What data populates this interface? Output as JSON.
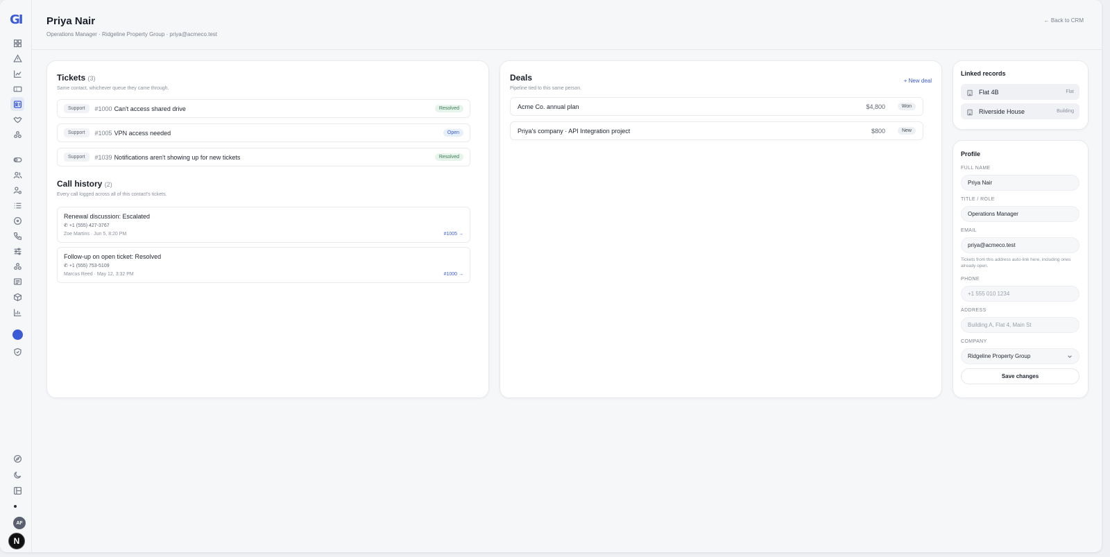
{
  "header": {
    "title": "Priya Nair",
    "subtitle": "Operations Manager · Ridgeline Property Group · priya@acmeco.test",
    "back_label": "← Back to CRM"
  },
  "sidebar": {
    "logo": "GI",
    "items": [
      "dashboard-icon",
      "alert-icon",
      "chart-icon",
      "ticket-icon",
      "contacts-icon",
      "handshake-icon",
      "integrations-icon",
      "toggle-icon",
      "users-icon",
      "user-settings-icon",
      "list-icon",
      "circle-icon",
      "phone-icon",
      "sliders-icon",
      "apps-icon",
      "message-icon",
      "box-icon",
      "bar-chart-icon",
      "shield-icon"
    ],
    "footer_items": [
      "compass-icon",
      "moon-icon",
      "layout-icon"
    ],
    "avatar_initials": "AF",
    "badge_letter": "N"
  },
  "tickets": {
    "title": "Tickets",
    "count": "(3)",
    "description": "Same contact, whichever queue they came through.",
    "items": [
      {
        "queue": "Support",
        "number": "#1000",
        "title": "Can't access shared drive",
        "status": "Resolved",
        "status_kind": "resolved"
      },
      {
        "queue": "Support",
        "number": "#1005",
        "title": "VPN access needed",
        "status": "Open",
        "status_kind": "open"
      },
      {
        "queue": "Support",
        "number": "#1039",
        "title": "Notifications aren't showing up for new tickets",
        "status": "Resolved",
        "status_kind": "resolved"
      }
    ]
  },
  "calls": {
    "title": "Call history",
    "count": "(2)",
    "description": "Every call logged across all of this contact's tickets.",
    "items": [
      {
        "title": "Renewal discussion: Escalated",
        "phone": "+1 (555) 427-3767",
        "meta": "Zoe Martins · Jun 5, 8:20 PM",
        "link": "#1005 →"
      },
      {
        "title": "Follow-up on open ticket: Resolved",
        "phone": "+1 (555) 753-5109",
        "meta": "Marcus Reed · May 12, 3:32 PM",
        "link": "#1000 →"
      }
    ]
  },
  "deals": {
    "title": "Deals",
    "description": "Pipeline tied to this same person.",
    "new_label": "+ New deal",
    "items": [
      {
        "name": "Acme Co. annual plan",
        "amount": "$4,800",
        "stage": "Won"
      },
      {
        "name": "Priya's company · API Integration project",
        "amount": "$800",
        "stage": "New"
      }
    ]
  },
  "linked": {
    "title": "Linked records",
    "items": [
      {
        "name": "Flat 4B",
        "type": "Flat"
      },
      {
        "name": "Riverside House",
        "type": "Building"
      }
    ]
  },
  "profile": {
    "title": "Profile",
    "full_name_label": "FULL NAME",
    "full_name": "Priya Nair",
    "role_label": "TITLE / ROLE",
    "role": "Operations Manager",
    "email_label": "EMAIL",
    "email": "priya@acmeco.test",
    "email_help": "Tickets from this address auto-link here, including ones already open.",
    "phone_label": "PHONE",
    "phone_placeholder": "+1 555 010 1234",
    "address_label": "ADDRESS",
    "address_placeholder": "Building A, Flat 4, Main St",
    "company_label": "COMPANY",
    "company": "Ridgeline Property Group",
    "save_label": "Save changes"
  },
  "colors": {
    "accent": "#3b5bd6",
    "resolved_bg": "#e7f4ec",
    "resolved_text": "#3d7a55",
    "open_bg": "#e6effc"
  }
}
